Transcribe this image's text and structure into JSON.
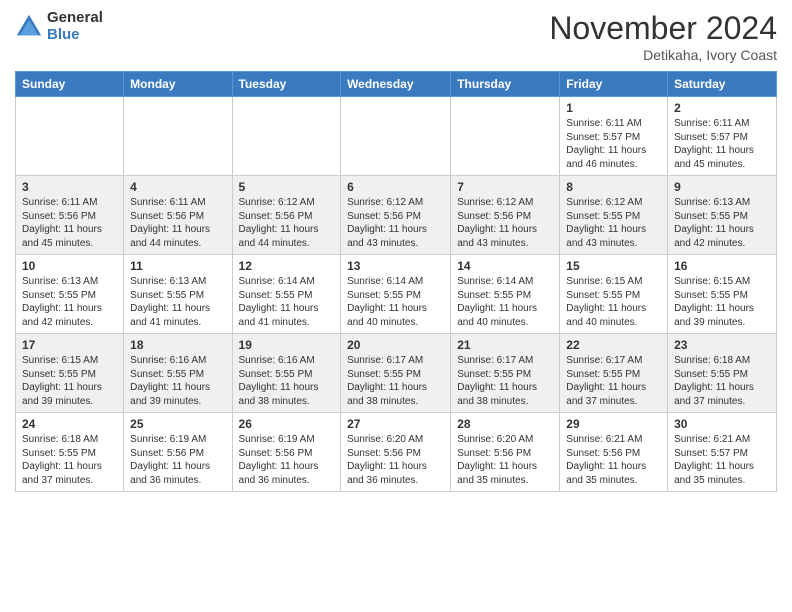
{
  "logo": {
    "general": "General",
    "blue": "Blue"
  },
  "title": "November 2024",
  "location": "Detikaha, Ivory Coast",
  "days_header": [
    "Sunday",
    "Monday",
    "Tuesday",
    "Wednesday",
    "Thursday",
    "Friday",
    "Saturday"
  ],
  "weeks": [
    [
      {
        "day": "",
        "info": ""
      },
      {
        "day": "",
        "info": ""
      },
      {
        "day": "",
        "info": ""
      },
      {
        "day": "",
        "info": ""
      },
      {
        "day": "",
        "info": ""
      },
      {
        "day": "1",
        "info": "Sunrise: 6:11 AM\nSunset: 5:57 PM\nDaylight: 11 hours\nand 46 minutes."
      },
      {
        "day": "2",
        "info": "Sunrise: 6:11 AM\nSunset: 5:57 PM\nDaylight: 11 hours\nand 45 minutes."
      }
    ],
    [
      {
        "day": "3",
        "info": "Sunrise: 6:11 AM\nSunset: 5:56 PM\nDaylight: 11 hours\nand 45 minutes."
      },
      {
        "day": "4",
        "info": "Sunrise: 6:11 AM\nSunset: 5:56 PM\nDaylight: 11 hours\nand 44 minutes."
      },
      {
        "day": "5",
        "info": "Sunrise: 6:12 AM\nSunset: 5:56 PM\nDaylight: 11 hours\nand 44 minutes."
      },
      {
        "day": "6",
        "info": "Sunrise: 6:12 AM\nSunset: 5:56 PM\nDaylight: 11 hours\nand 43 minutes."
      },
      {
        "day": "7",
        "info": "Sunrise: 6:12 AM\nSunset: 5:56 PM\nDaylight: 11 hours\nand 43 minutes."
      },
      {
        "day": "8",
        "info": "Sunrise: 6:12 AM\nSunset: 5:55 PM\nDaylight: 11 hours\nand 43 minutes."
      },
      {
        "day": "9",
        "info": "Sunrise: 6:13 AM\nSunset: 5:55 PM\nDaylight: 11 hours\nand 42 minutes."
      }
    ],
    [
      {
        "day": "10",
        "info": "Sunrise: 6:13 AM\nSunset: 5:55 PM\nDaylight: 11 hours\nand 42 minutes."
      },
      {
        "day": "11",
        "info": "Sunrise: 6:13 AM\nSunset: 5:55 PM\nDaylight: 11 hours\nand 41 minutes."
      },
      {
        "day": "12",
        "info": "Sunrise: 6:14 AM\nSunset: 5:55 PM\nDaylight: 11 hours\nand 41 minutes."
      },
      {
        "day": "13",
        "info": "Sunrise: 6:14 AM\nSunset: 5:55 PM\nDaylight: 11 hours\nand 40 minutes."
      },
      {
        "day": "14",
        "info": "Sunrise: 6:14 AM\nSunset: 5:55 PM\nDaylight: 11 hours\nand 40 minutes."
      },
      {
        "day": "15",
        "info": "Sunrise: 6:15 AM\nSunset: 5:55 PM\nDaylight: 11 hours\nand 40 minutes."
      },
      {
        "day": "16",
        "info": "Sunrise: 6:15 AM\nSunset: 5:55 PM\nDaylight: 11 hours\nand 39 minutes."
      }
    ],
    [
      {
        "day": "17",
        "info": "Sunrise: 6:15 AM\nSunset: 5:55 PM\nDaylight: 11 hours\nand 39 minutes."
      },
      {
        "day": "18",
        "info": "Sunrise: 6:16 AM\nSunset: 5:55 PM\nDaylight: 11 hours\nand 39 minutes."
      },
      {
        "day": "19",
        "info": "Sunrise: 6:16 AM\nSunset: 5:55 PM\nDaylight: 11 hours\nand 38 minutes."
      },
      {
        "day": "20",
        "info": "Sunrise: 6:17 AM\nSunset: 5:55 PM\nDaylight: 11 hours\nand 38 minutes."
      },
      {
        "day": "21",
        "info": "Sunrise: 6:17 AM\nSunset: 5:55 PM\nDaylight: 11 hours\nand 38 minutes."
      },
      {
        "day": "22",
        "info": "Sunrise: 6:17 AM\nSunset: 5:55 PM\nDaylight: 11 hours\nand 37 minutes."
      },
      {
        "day": "23",
        "info": "Sunrise: 6:18 AM\nSunset: 5:55 PM\nDaylight: 11 hours\nand 37 minutes."
      }
    ],
    [
      {
        "day": "24",
        "info": "Sunrise: 6:18 AM\nSunset: 5:55 PM\nDaylight: 11 hours\nand 37 minutes."
      },
      {
        "day": "25",
        "info": "Sunrise: 6:19 AM\nSunset: 5:56 PM\nDaylight: 11 hours\nand 36 minutes."
      },
      {
        "day": "26",
        "info": "Sunrise: 6:19 AM\nSunset: 5:56 PM\nDaylight: 11 hours\nand 36 minutes."
      },
      {
        "day": "27",
        "info": "Sunrise: 6:20 AM\nSunset: 5:56 PM\nDaylight: 11 hours\nand 36 minutes."
      },
      {
        "day": "28",
        "info": "Sunrise: 6:20 AM\nSunset: 5:56 PM\nDaylight: 11 hours\nand 35 minutes."
      },
      {
        "day": "29",
        "info": "Sunrise: 6:21 AM\nSunset: 5:56 PM\nDaylight: 11 hours\nand 35 minutes."
      },
      {
        "day": "30",
        "info": "Sunrise: 6:21 AM\nSunset: 5:57 PM\nDaylight: 11 hours\nand 35 minutes."
      }
    ]
  ]
}
